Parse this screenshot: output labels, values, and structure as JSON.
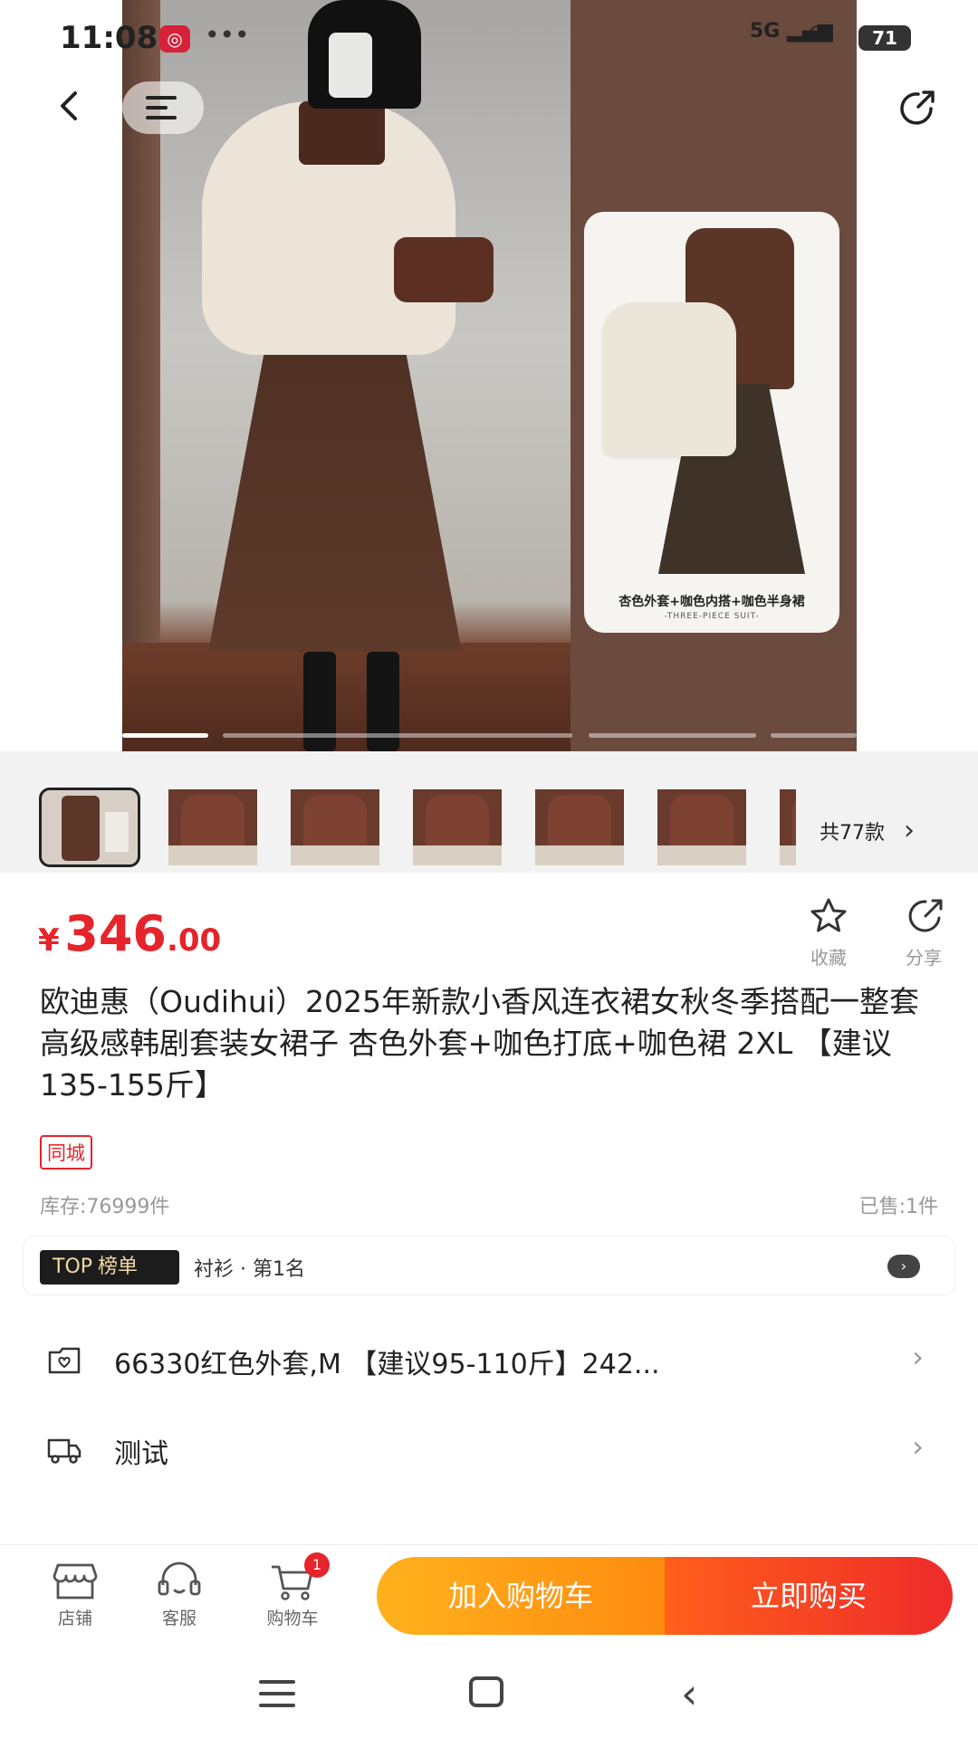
{
  "status_bar": {
    "time": "11:08",
    "app_icon": "bank-app-icon",
    "dots": "•••",
    "network": "5G",
    "battery": "71"
  },
  "top_nav": {
    "back_icon": "chevron-left-icon",
    "menu_icon": "menu-icon",
    "share_icon": "share-icon"
  },
  "hero": {
    "card_caption": "杏色外套+咖色内搭+咖色半身裙",
    "card_subcaption": "-THREE-PIECE SUIT-",
    "gallery_index": 1,
    "gallery_count": 5
  },
  "thumbnails": {
    "more_label": "共77款",
    "more_chevron": "›"
  },
  "product": {
    "currency": "¥",
    "price_int": "346",
    "price_dec": ".00",
    "favorite_label": "收藏",
    "share_label": "分享",
    "title": "欧迪惠（Oudihui）2025年新款小香风连衣裙女秋冬季搭配一整套高级感韩剧套装女裙子 杏色外套+咖色打底+咖色裙 2XL 【建议135-155斤】",
    "tag": "同城",
    "stock": "库存:76999件",
    "sold": "已售:1件"
  },
  "ranking": {
    "badge_top": "TOP",
    "badge_label": "榜单",
    "text": "衬衫 · 第1名"
  },
  "options": [
    {
      "icon": "heart-bag-icon",
      "text": "66330红色外套,M 【建议95-110斤】242..."
    },
    {
      "icon": "delivery-truck-icon",
      "text": "测试"
    }
  ],
  "bottom_bar": {
    "store_label": "店铺",
    "service_label": "客服",
    "cart_label": "购物车",
    "cart_count": "1",
    "add_to_cart": "加入购物车",
    "buy_now": "立即购买"
  },
  "colors": {
    "accent_red": "#e5242b",
    "cart_orange": "#ff9a14",
    "buy_red": "#ee2b2a"
  }
}
